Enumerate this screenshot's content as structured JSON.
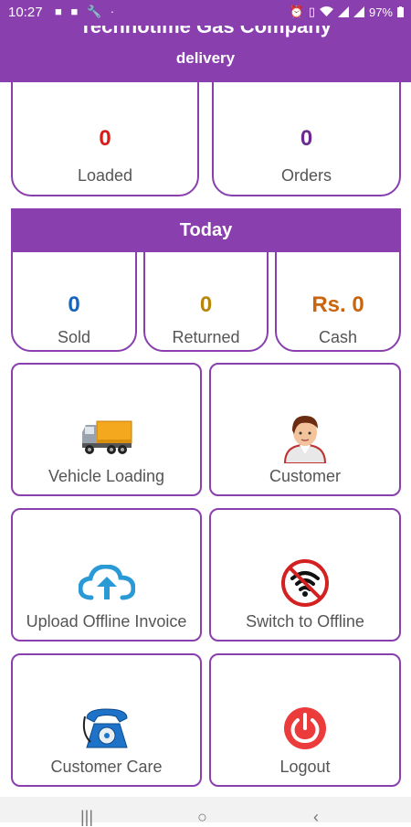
{
  "status_bar": {
    "time": "10:27",
    "battery": "97%",
    "icons_left": [
      "video-icon",
      "video-icon",
      "wrench-icon",
      "dot-icon"
    ],
    "icons_right": [
      "alarm-icon",
      "vibrate-icon",
      "wifi-icon",
      "signal-icon",
      "signal-icon",
      "battery-icon"
    ]
  },
  "header": {
    "title": "Technotime Gas Company",
    "subtitle": "delivery"
  },
  "summary": [
    {
      "value": "0",
      "label": "Loaded",
      "color": "#d81b1b"
    },
    {
      "value": "0",
      "label": "Orders",
      "color": "#6b2a8f"
    }
  ],
  "today": {
    "title": "Today",
    "stats": [
      {
        "value": "0",
        "label": "Sold",
        "color": "#1565c0"
      },
      {
        "value": "0",
        "label": "Returned",
        "color": "#b8860b"
      },
      {
        "value": "Rs. 0",
        "label": "Cash",
        "color": "#c9650e"
      }
    ]
  },
  "tiles": [
    {
      "label": "Vehicle Loading",
      "icon": "truck-icon"
    },
    {
      "label": "Customer",
      "icon": "customer-icon"
    },
    {
      "label": "Upload Offline Invoice",
      "icon": "cloud-upload-icon"
    },
    {
      "label": "Switch to Offline",
      "icon": "wifi-off-icon"
    },
    {
      "label": "Customer Care",
      "icon": "telephone-icon"
    },
    {
      "label": "Logout",
      "icon": "power-icon"
    }
  ],
  "colors": {
    "primary": "#8a3fae",
    "loaded": "#d81b1b",
    "orders": "#6b2a8f",
    "sold": "#1565c0",
    "returned": "#b8860b",
    "cash": "#c9650e"
  }
}
